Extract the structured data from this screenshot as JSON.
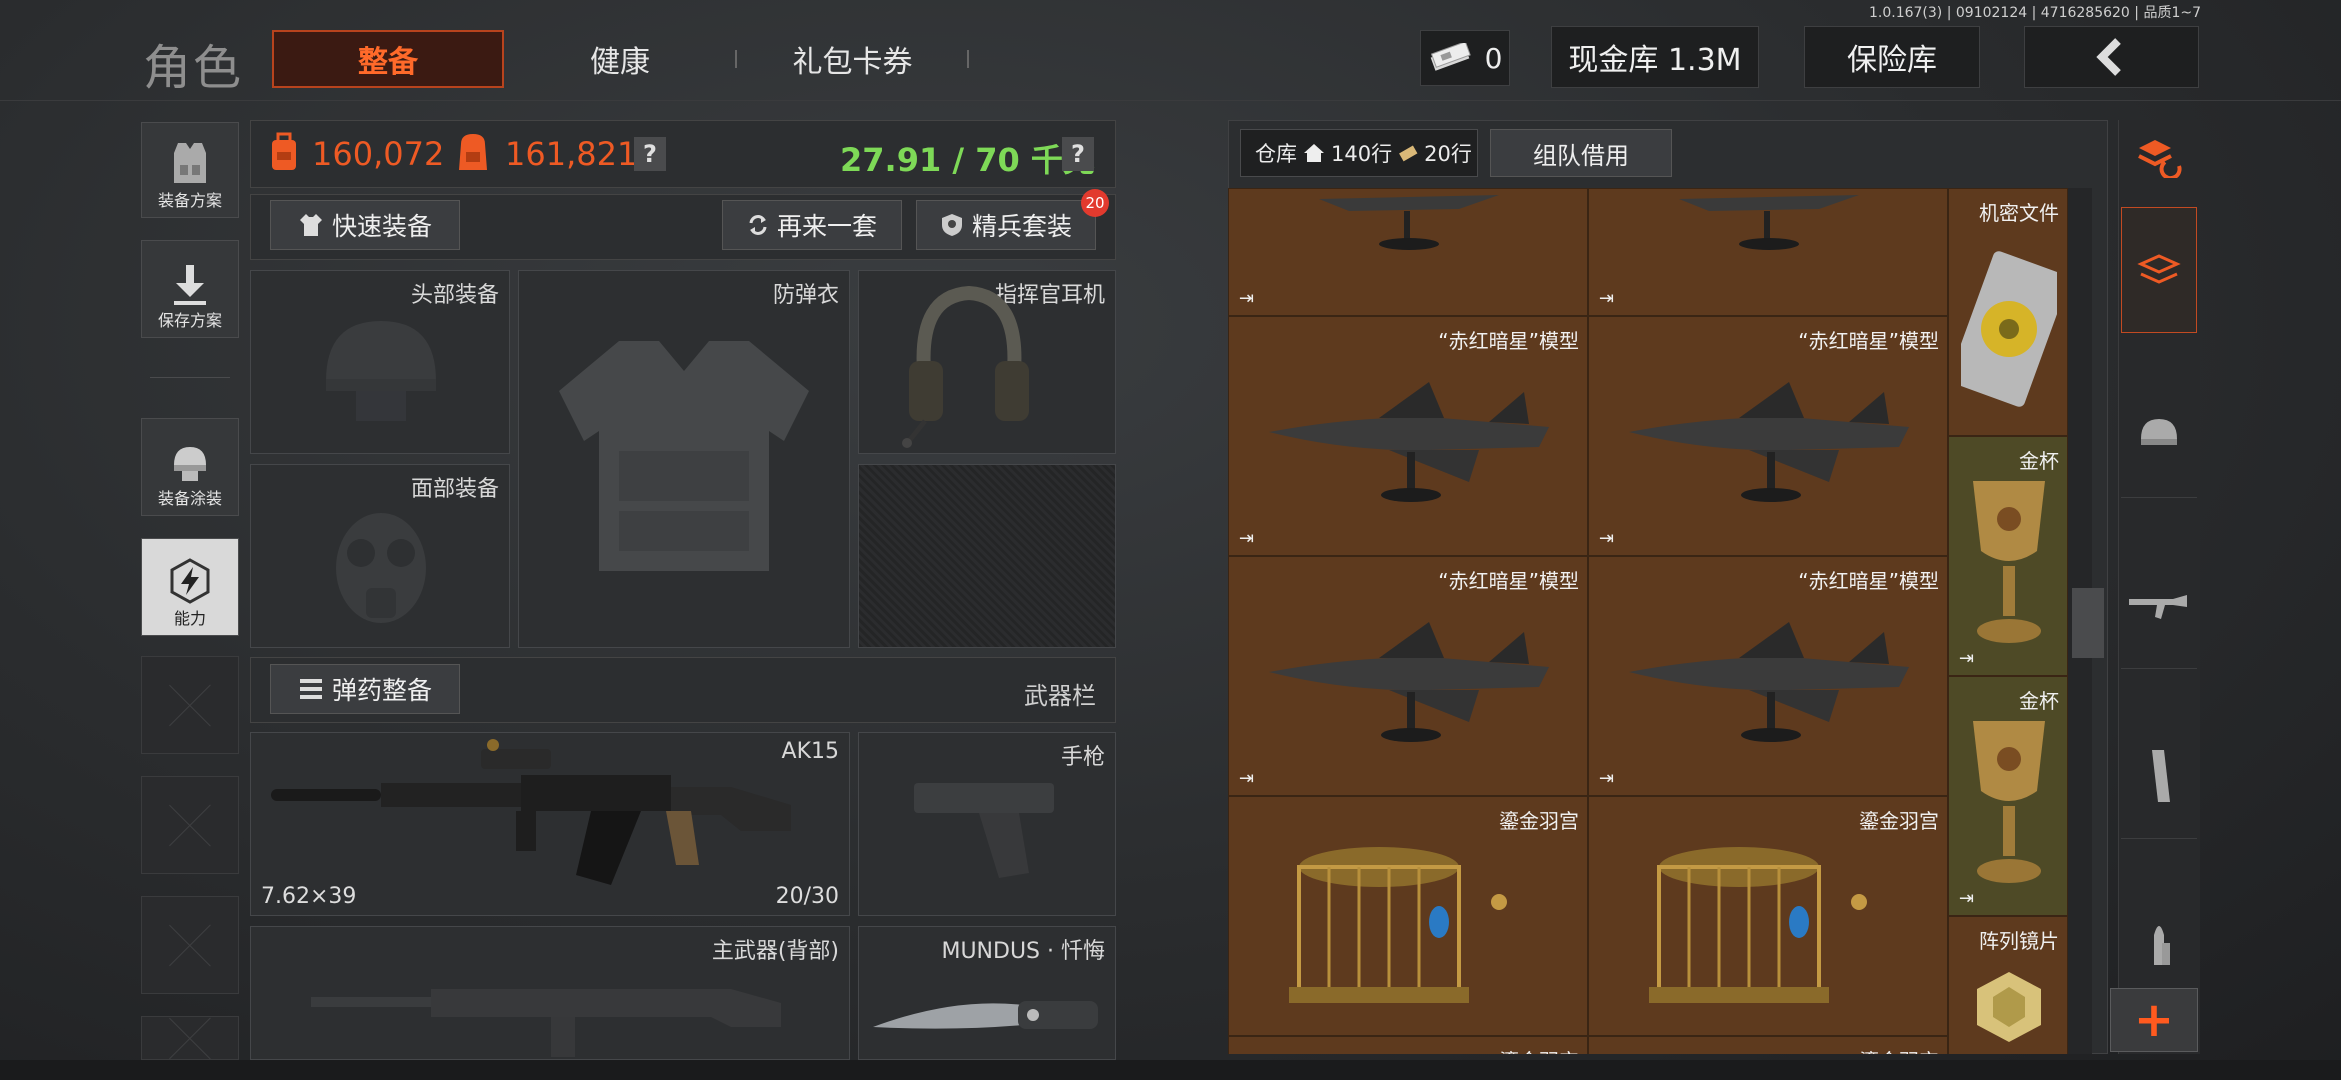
{
  "version": "1.0.167(3) | 09102124 | 4716285620 | 品质1~7",
  "header": {
    "title": "角色",
    "tabs": [
      "整备",
      "健康",
      "礼包卡券"
    ],
    "money_count": "0",
    "cash_label": "现金库 1.3M",
    "safe_label": "保险库"
  },
  "left_tools": [
    "装备方案",
    "保存方案",
    "装备涂装",
    "能力"
  ],
  "stats": {
    "value1": "160,072",
    "value2": "161,821",
    "weight": "27.91 / 70 千克",
    "q": "?"
  },
  "buttons": {
    "quick_equip": "快速装备",
    "again": "再来一套",
    "elite": "精兵套装",
    "elite_badge": "20",
    "ammo": "弹药整备"
  },
  "slots": {
    "head": "头部装备",
    "armor": "防弹衣",
    "headset": "指挥官耳机",
    "face": "面部装备",
    "weapon_bar": "武器栏",
    "ak": "AK15",
    "ak_caliber": "7.62×39",
    "ak_ammo": "20/30",
    "pistol": "手枪",
    "primary_back": "主武器(背部)",
    "melee": "MUNDUS · 忏悔"
  },
  "warehouse": {
    "label": "仓库",
    "rows": "140行",
    "extra": "20行",
    "team_borrow": "组队借用",
    "items": [
      "机密文件",
      "“赤红暗星”模型",
      "“赤红暗星”模型",
      "“赤红暗星”模型",
      "“赤红暗星”模型",
      "金杯",
      "金杯",
      "鎏金羽宫",
      "鎏金羽宫",
      "阵列镜片",
      "鎏金羽宫",
      "鎏金羽宫"
    ]
  },
  "colors": {
    "accent": "#ee5a24",
    "weight_green": "#7ed957",
    "item_bg": "#5e3a1e"
  }
}
